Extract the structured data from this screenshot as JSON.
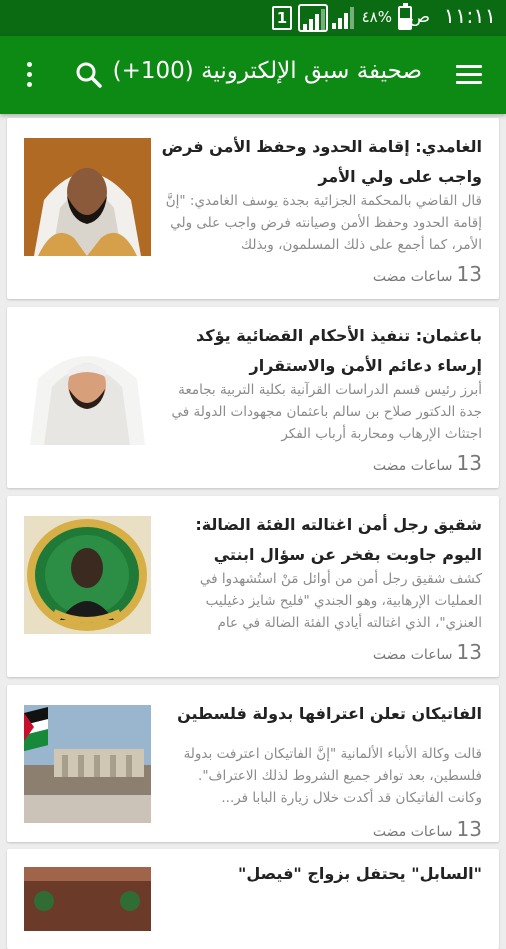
{
  "status_bar": {
    "time": "١١:١١",
    "am_pm": "ص",
    "battery_percent": "٤٨%",
    "battery_level": 0.48,
    "sim_slot": "1"
  },
  "toolbar": {
    "title": "صحيفة سبق الإلكترونية (100+)",
    "menu_icon": "hamburger-menu-icon",
    "search_icon": "search-icon",
    "overflow_icon": "more-vertical-icon"
  },
  "articles": [
    {
      "title": "الغامدي: إقامة الحدود وحفظ الأمن فرض واجب على ولي الأمر",
      "snippet": "قال القاضي بالمحكمة الجزائية بجدة يوسف الغامدي: \"إنَّ إقامة الحدود وحفظ الأمن وصيانته فرض واجب على ولي الأمر، كما أجمع على ذلك المسلمون، وبذلك",
      "time_number": "13",
      "time_label": "ساعات مضت"
    },
    {
      "title": "باعثمان: تنفيذ الأحكام القضائية يؤكد إرساء دعائم الأمن والاستقرار",
      "snippet": "أبرز رئيس قسم الدراسات القرآنية بكلية التربية بجامعة جدة الدكتور صلاح بن سالم باعثمان مجهودات الدولة في اجتثاث الإرهاب ومحاربة أرباب الفكر",
      "time_number": "13",
      "time_label": "ساعات مضت"
    },
    {
      "title": "شقيق رجل أمن اغتالته الفئة الضالة: اليوم جاوبت بفخر عن سؤال ابنتي",
      "snippet": "كشف شقيق رجل أمن من أوائل مَنْ استُشهدوا في العمليات الإرهابية، وهو الجندي \"فليح شايز دغيليب العنزي\"، الذي اغتالته أيادي الفئة الضالة في عام",
      "time_number": "13",
      "time_label": "ساعات مضت"
    },
    {
      "title": "الفاتيكان تعلن اعترافها بدولة فلسطين",
      "snippet": "قالت وكالة الأنباء الألمانية \"إنَّ الفاتيكان اعترفت بدولة فلسطين، بعد توافر جميع الشروط لذلك الاعتراف\". وكانت الفاتيكان قد أكدت خلال زيارة البابا فر...",
      "time_number": "13",
      "time_label": "ساعات مضت"
    },
    {
      "title": "\"السابل\" يحتفل بزواج \"فيصل\"",
      "snippet": "",
      "time_number": "",
      "time_label": ""
    }
  ]
}
